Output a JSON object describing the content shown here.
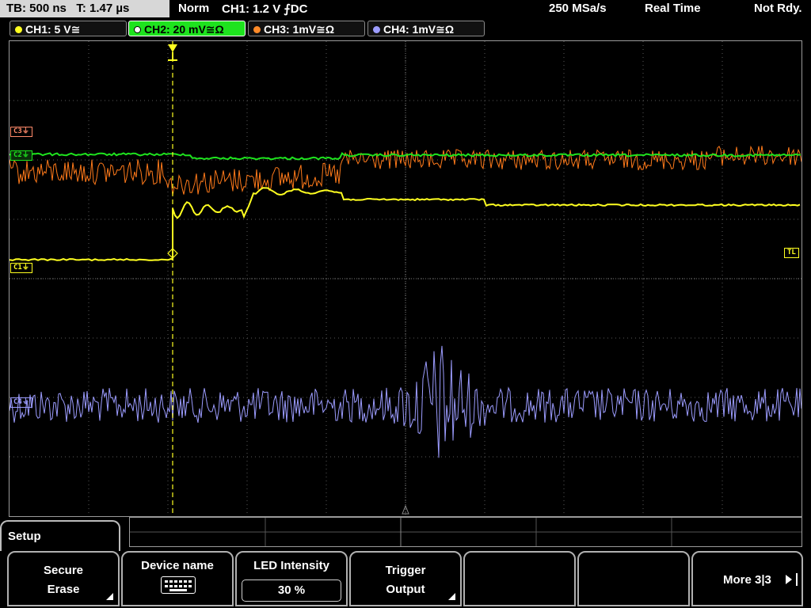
{
  "status_bar": {
    "timebase": "TB: 500 ns",
    "trigger_time": "T: 1.47 µs",
    "trigger_mode": "Norm",
    "trigger_source": "CH1: 1.2 V ⨍DC",
    "sample_rate": "250 MSa/s",
    "acq_mode": "Real Time",
    "status": "Not Rdy."
  },
  "channels": [
    {
      "label": "CH1: 5 V≅",
      "color": "#ffff20",
      "active": false
    },
    {
      "label": "CH2: 20 mV≅Ω",
      "color": "#1ee31e",
      "active": true
    },
    {
      "label": "CH3: 1mV≅Ω",
      "color": "#ff8a28",
      "active": false
    },
    {
      "label": "CH4: 1mV≅Ω",
      "color": "#9c9cff",
      "active": false
    }
  ],
  "markers": {
    "c3": "C3⏚",
    "c2": "C2⏚",
    "c1": "C1⏚",
    "c4": "C4⏚",
    "tl": "TL"
  },
  "colors": {
    "ch1": "#ffff20",
    "ch2": "#1ee31e",
    "ch3": "#ff7a1a",
    "ch4": "#9c9cff",
    "grid": "#5a5a5a",
    "trigger": "#ffff20"
  },
  "menu": {
    "title": "Setup",
    "softkeys": [
      {
        "line1": "Secure",
        "line2": "Erase",
        "has_submenu": true
      },
      {
        "line1": "Device name",
        "icon": "keyboard-icon"
      },
      {
        "line1": "LED Intensity",
        "value": "30 %"
      },
      {
        "line1": "Trigger",
        "line2": "Output",
        "has_submenu": true
      },
      {
        "line1": ""
      },
      {
        "line1": ""
      }
    ],
    "more": "More 3|3"
  }
}
